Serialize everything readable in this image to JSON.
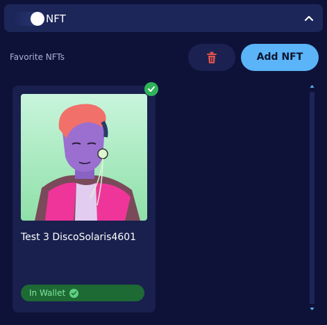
{
  "header": {
    "title": "NFT",
    "toggle_on": true,
    "chevron_icon": "chevron-up-icon"
  },
  "favorites": {
    "label": "Favorite NFTs",
    "delete_icon": "trash-icon",
    "add_label": "Add NFT"
  },
  "cards": [
    {
      "title": "Test 3 DiscoSolaris4601",
      "badge": "In Wallet",
      "selected": true
    }
  ],
  "colors": {
    "background": "#0e1238",
    "header": "#1c2658",
    "accent": "#5ab4f7",
    "danger": "#e0524a",
    "success": "#2fb35a"
  }
}
